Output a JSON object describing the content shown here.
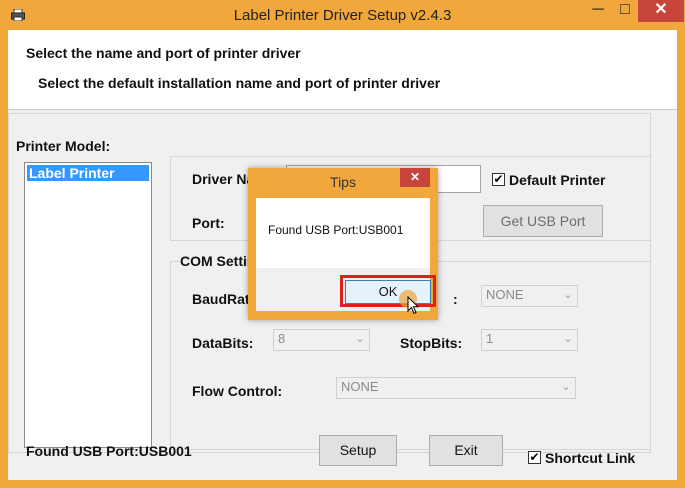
{
  "window": {
    "title": "Label Printer Driver Setup v2.4.3",
    "min_glyph": "─",
    "max_glyph": "□",
    "close_glyph": "✕"
  },
  "header": {
    "line1": "Select the name and port of printer driver",
    "line2": "Select the default installation name and port of printer driver"
  },
  "printer_model": {
    "label": "Printer Model:",
    "items": [
      "Label Printer"
    ],
    "selected": "Label Printer"
  },
  "driver": {
    "name_label": "Driver Na",
    "name_value": "",
    "port_label": "Port:",
    "default_printer_label": "Default Printer",
    "default_printer_checked": true,
    "get_usb_port_label": "Get USB Port"
  },
  "com": {
    "group_label": "COM Settin",
    "baud_label": "BaudRat",
    "parity_value": "NONE",
    "databits_label": "DataBits:",
    "databits_value": "8",
    "stopbits_label": "StopBits:",
    "stopbits_value": "1",
    "flow_label": "Flow Control:",
    "flow_value": "NONE"
  },
  "footer": {
    "status": "Found USB Port:USB001",
    "setup_label": "Setup",
    "exit_label": "Exit",
    "shortcut_label": "Shortcut Link",
    "shortcut_checked": true
  },
  "dialog": {
    "title": "Tips",
    "message": "Found USB Port:USB001",
    "ok_label": "OK",
    "close_glyph": "✕"
  },
  "icons": {
    "check": "✔",
    "dropdown": "⌄"
  }
}
